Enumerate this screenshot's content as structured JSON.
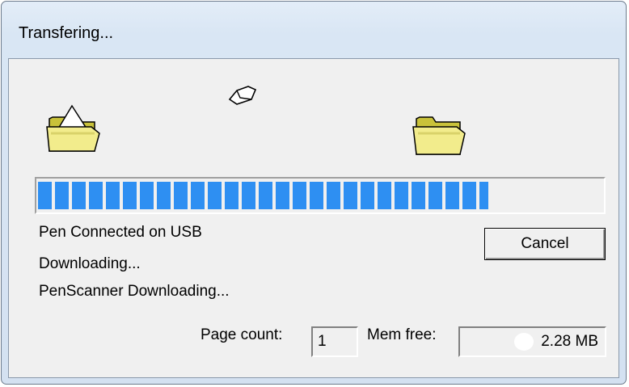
{
  "window": {
    "title": "Transfering..."
  },
  "icons": {
    "source": "open-folder-with-document-icon",
    "flying": "flying-document-icon",
    "destination": "open-folder-icon"
  },
  "progress": {
    "fraction": 0.795,
    "color": "#2e8ff2"
  },
  "status": {
    "line1": "Pen Connected on USB",
    "line2": "Downloading...",
    "line3": "PenScanner Downloading..."
  },
  "buttons": {
    "cancel": "Cancel"
  },
  "stats": {
    "page_count_label": "Page count:",
    "page_count_value": "1",
    "mem_free_label": "Mem free:",
    "mem_free_value": "2.28 MB"
  }
}
